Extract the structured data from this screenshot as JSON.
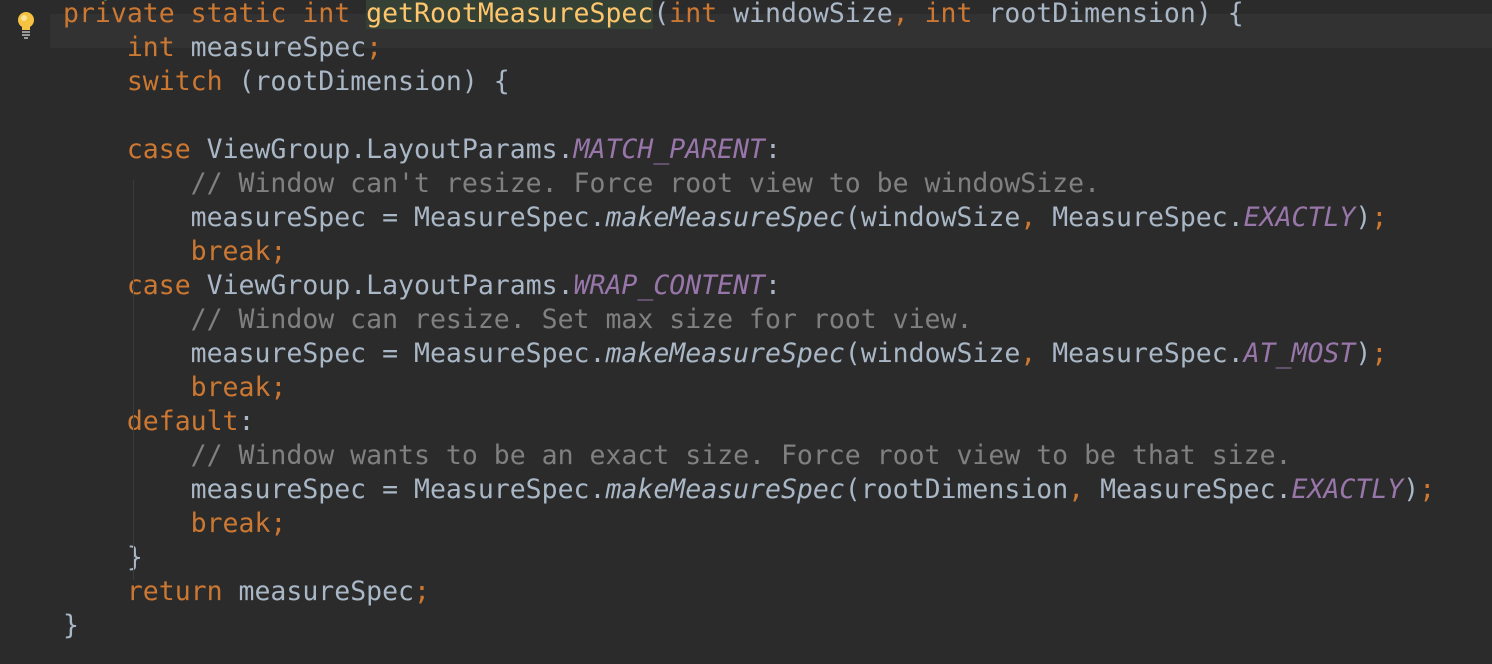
{
  "editor": {
    "top_fragment": "*/",
    "lines": [
      {
        "indent": 0,
        "tokens": [
          {
            "t": "private static int ",
            "c": "kw"
          },
          {
            "t": "getRootMeasureSpec",
            "c": "fn"
          },
          {
            "t": "(",
            "c": ""
          },
          {
            "t": "int ",
            "c": "kw"
          },
          {
            "t": "windowSize",
            "c": ""
          },
          {
            "t": ", ",
            "c": "kw"
          },
          {
            "t": "int ",
            "c": "kw"
          },
          {
            "t": "rootDimension) {",
            "c": ""
          }
        ]
      },
      {
        "indent": 1,
        "tokens": [
          {
            "t": "int ",
            "c": "kw"
          },
          {
            "t": "measureSpec",
            "c": ""
          },
          {
            "t": ";",
            "c": "kw"
          }
        ]
      },
      {
        "indent": 1,
        "tokens": [
          {
            "t": "switch ",
            "c": "kw"
          },
          {
            "t": "(rootDimension) {",
            "c": ""
          }
        ]
      },
      {
        "indent": 0,
        "tokens": []
      },
      {
        "indent": 1,
        "tokens": [
          {
            "t": "case ",
            "c": "kw"
          },
          {
            "t": "ViewGroup.LayoutParams.",
            "c": ""
          },
          {
            "t": "MATCH_PARENT",
            "c": "cn"
          },
          {
            "t": ":",
            "c": ""
          }
        ]
      },
      {
        "indent": 2,
        "tokens": [
          {
            "t": "// Window can't resize. Force root view to be windowSize.",
            "c": "cm"
          }
        ]
      },
      {
        "indent": 2,
        "tokens": [
          {
            "t": "measureSpec = MeasureSpec.",
            "c": ""
          },
          {
            "t": "makeMeasureSpec",
            "c": "it"
          },
          {
            "t": "(windowSize",
            "c": ""
          },
          {
            "t": ", ",
            "c": "kw"
          },
          {
            "t": "MeasureSpec.",
            "c": ""
          },
          {
            "t": "EXACTLY",
            "c": "cn"
          },
          {
            "t": ")",
            "c": ""
          },
          {
            "t": ";",
            "c": "kw"
          }
        ]
      },
      {
        "indent": 2,
        "tokens": [
          {
            "t": "break;",
            "c": "kw"
          }
        ]
      },
      {
        "indent": 1,
        "tokens": [
          {
            "t": "case ",
            "c": "kw"
          },
          {
            "t": "ViewGroup.LayoutParams.",
            "c": ""
          },
          {
            "t": "WRAP_CONTENT",
            "c": "cn"
          },
          {
            "t": ":",
            "c": ""
          }
        ]
      },
      {
        "indent": 2,
        "tokens": [
          {
            "t": "// Window can resize. Set max size for root view.",
            "c": "cm"
          }
        ]
      },
      {
        "indent": 2,
        "tokens": [
          {
            "t": "measureSpec = MeasureSpec.",
            "c": ""
          },
          {
            "t": "makeMeasureSpec",
            "c": "it"
          },
          {
            "t": "(windowSize",
            "c": ""
          },
          {
            "t": ", ",
            "c": "kw"
          },
          {
            "t": "MeasureSpec.",
            "c": ""
          },
          {
            "t": "AT_MOST",
            "c": "cn"
          },
          {
            "t": ")",
            "c": ""
          },
          {
            "t": ";",
            "c": "kw"
          }
        ]
      },
      {
        "indent": 2,
        "tokens": [
          {
            "t": "break;",
            "c": "kw"
          }
        ]
      },
      {
        "indent": 1,
        "tokens": [
          {
            "t": "default",
            "c": "kw"
          },
          {
            "t": ":",
            "c": ""
          }
        ]
      },
      {
        "indent": 2,
        "tokens": [
          {
            "t": "// Window wants to be an exact size. Force root view to be that size.",
            "c": "cm"
          }
        ]
      },
      {
        "indent": 2,
        "tokens": [
          {
            "t": "measureSpec = MeasureSpec.",
            "c": ""
          },
          {
            "t": "makeMeasureSpec",
            "c": "it"
          },
          {
            "t": "(rootDimension",
            "c": ""
          },
          {
            "t": ", ",
            "c": "kw"
          },
          {
            "t": "MeasureSpec.",
            "c": ""
          },
          {
            "t": "EXACTLY",
            "c": "cn"
          },
          {
            "t": ")",
            "c": ""
          },
          {
            "t": ";",
            "c": "kw"
          }
        ]
      },
      {
        "indent": 2,
        "tokens": [
          {
            "t": "break;",
            "c": "kw"
          }
        ]
      },
      {
        "indent": 1,
        "tokens": [
          {
            "t": "}",
            "c": ""
          }
        ]
      },
      {
        "indent": 1,
        "tokens": [
          {
            "t": "return ",
            "c": "kw"
          },
          {
            "t": "measureSpec",
            "c": ""
          },
          {
            "t": ";",
            "c": "kw"
          }
        ]
      },
      {
        "indent": 0,
        "tokens": [
          {
            "t": "}",
            "c": ""
          }
        ]
      }
    ]
  },
  "colors": {
    "background": "#2b2b2b",
    "keyword": "#cc7832",
    "method_declaration": "#ffc66d",
    "comment": "#808080",
    "constant": "#9876aa",
    "default_text": "#a9b7c6"
  },
  "icons": {
    "gutter_icon": "lightbulb-icon"
  }
}
